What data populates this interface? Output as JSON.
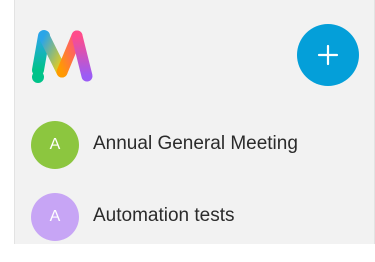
{
  "header": {
    "logo_icon": "webex-teams-logo-icon",
    "add_button_icon": "plus-icon",
    "accent_color": "#049fd9"
  },
  "spaces": [
    {
      "initial": "A",
      "name": "Annual General Meeting",
      "avatar_color": "#8cc63f"
    },
    {
      "initial": "A",
      "name": "Automation tests",
      "avatar_color": "#c7a5f5"
    }
  ]
}
